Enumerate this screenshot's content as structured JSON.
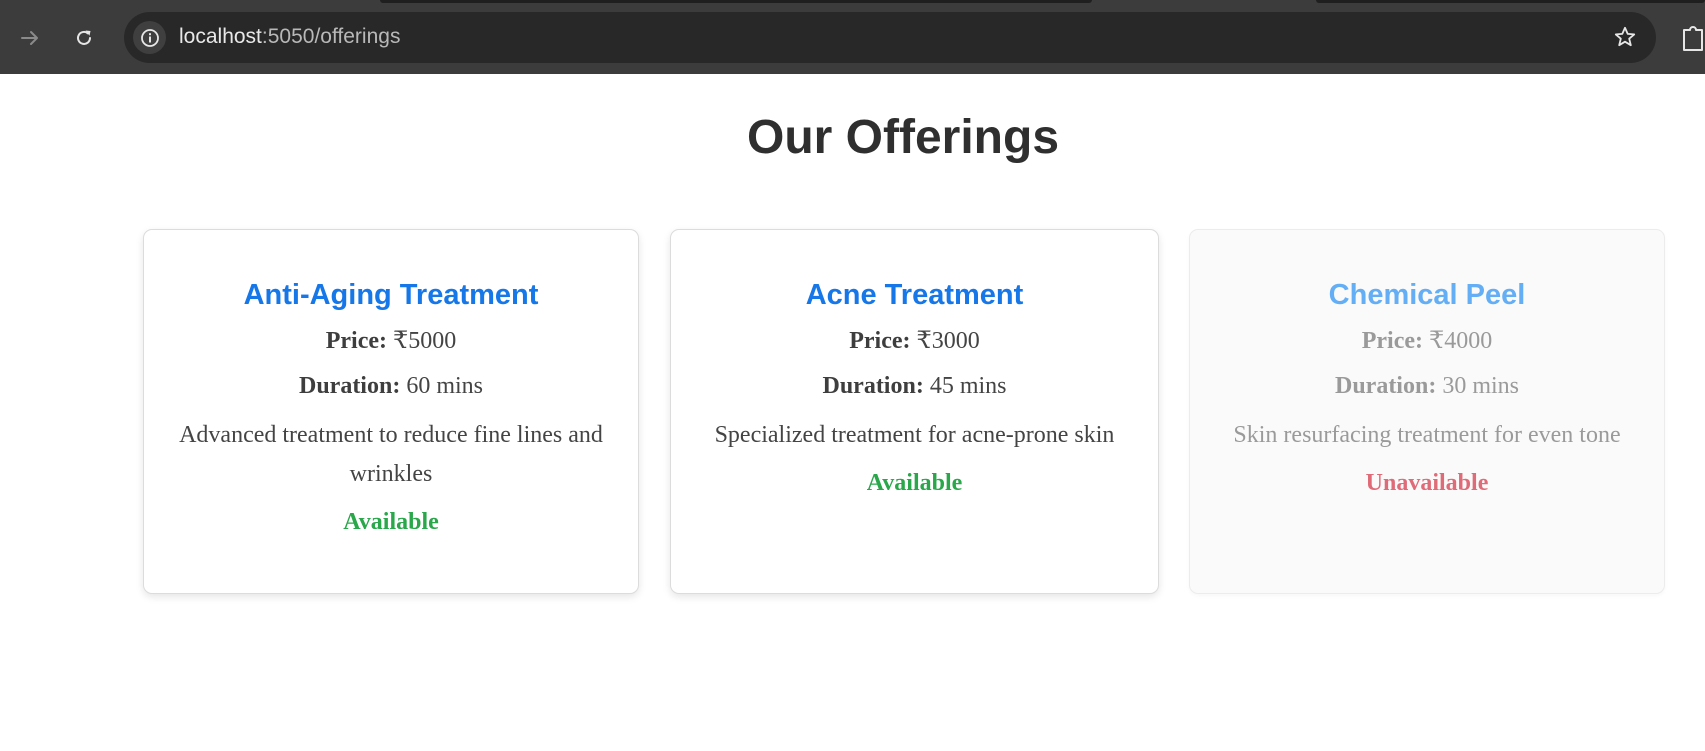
{
  "browser": {
    "url_host": "localhost",
    "url_path": ":5050/offerings"
  },
  "page": {
    "title": "Our Offerings"
  },
  "labels": {
    "price": "Price:",
    "duration": "Duration:"
  },
  "offerings": [
    {
      "name": "Anti-Aging Treatment",
      "price": "₹5000",
      "duration": "60 mins",
      "description": "Advanced treatment to reduce fine lines and wrinkles",
      "status": "Available"
    },
    {
      "name": "Acne Treatment",
      "price": "₹3000",
      "duration": "45 mins",
      "description": "Specialized treatment for acne-prone skin",
      "status": "Available"
    },
    {
      "name": "Chemical Peel",
      "price": "₹4000",
      "duration": "30 mins",
      "description": "Skin resurfacing treatment for even tone",
      "status": "Unavailable"
    }
  ],
  "colors": {
    "accent": "#1577e8",
    "available": "#29a74a",
    "unavailable": "#e06b78"
  },
  "icons": [
    "forward-icon",
    "reload-icon",
    "site-info-icon",
    "bookmark-star-icon",
    "extensions-icon"
  ]
}
